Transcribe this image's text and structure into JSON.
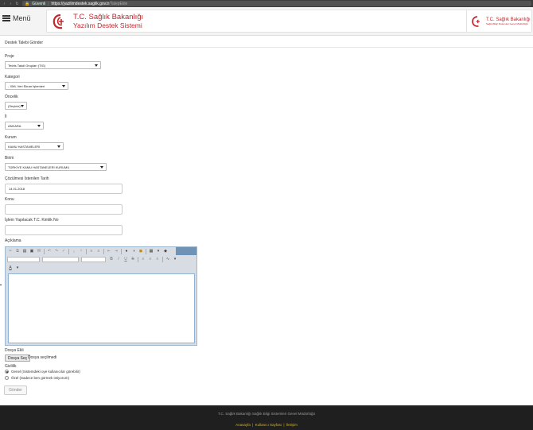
{
  "browser": {
    "secure_label": "Güvenli",
    "url_host": "https://yazilimdestek.saglik.gov.tr",
    "url_path": "/TalepEkle"
  },
  "header": {
    "menu_label": "Menü",
    "brand_title": "T.C. Sağlık Bakanlığı",
    "brand_subtitle": "Yazılım Destek Sistemi",
    "right_title": "T.C. Sağlık Bakanlığı",
    "right_subtitle": "Sağlık Bilgi Sistemleri Genel Müdürlüğü",
    "accent_color": "#c2272d"
  },
  "page": {
    "title": "Destek Talebi Gönder"
  },
  "form": {
    "proje": {
      "label": "Proje",
      "value": "Tedris Takdi Grupları (TİG)"
    },
    "kategori": {
      "label": "Kategori",
      "value": "- XML Veri Ekran İşlemleri"
    },
    "oncelik": {
      "label": "Öncelik",
      "value": "(Seçiniz)"
    },
    "il": {
      "label": "İl",
      "value": "ANKARA"
    },
    "kurum": {
      "label": "Kurum",
      "value": "KAMU HASTANELERİ"
    },
    "birim": {
      "label": "Birim",
      "value": "TÜRKİYE KAMU HASTANELERİ KURUMU"
    },
    "tarih": {
      "label": "Çözülmesi İstenilen Tarih",
      "value": "14.01.2018"
    },
    "konu": {
      "label": "Konu",
      "value": ""
    },
    "kimlik": {
      "label": "İşlem Yapılacak T.C. Kimlik No",
      "value": ""
    },
    "aciklama": {
      "label": "Açıklama"
    },
    "dosya": {
      "label": "Dosya Ekli",
      "button": "Dosya Seç",
      "status": "Dosya seçilmedi"
    },
    "gizlilik": {
      "label": "Gizlilik",
      "options": [
        {
          "label": "Genel (Sistemdeki oye kullanıcılar görebilir)",
          "checked": true
        },
        {
          "label": "Özel (Sadece ben görmek istiyorum)",
          "checked": false
        }
      ]
    },
    "submit_label": "Gönder"
  },
  "footer": {
    "org": "T.C. Sağlık Bakanlığı Sağlık Bilgi Sistemleri Genel Müdürlüğü",
    "links": [
      "Anasayfa",
      "Kullanıcı Sayfası",
      "İletişim"
    ],
    "link_color": "#e0b400"
  }
}
